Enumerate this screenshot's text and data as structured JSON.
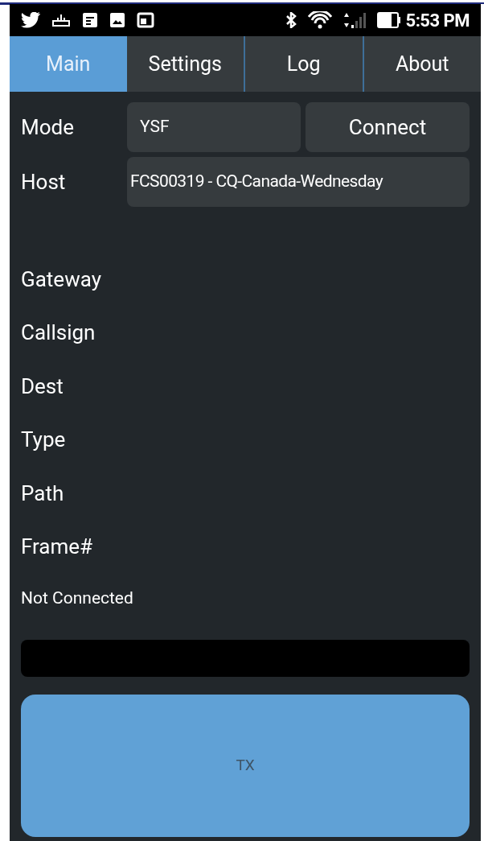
{
  "status_bar": {
    "time": "5:53 PM"
  },
  "tabs": [
    {
      "label": "Main",
      "selected": true
    },
    {
      "label": "Settings",
      "selected": false
    },
    {
      "label": "Log",
      "selected": false
    },
    {
      "label": "About",
      "selected": false
    }
  ],
  "mode": {
    "label": "Mode",
    "value": "YSF"
  },
  "connect_button": {
    "label": "Connect"
  },
  "host": {
    "label": "Host",
    "value": "FCS00319 - CQ-Canada-Wednesday"
  },
  "fields": [
    {
      "label": "Gateway"
    },
    {
      "label": "Callsign"
    },
    {
      "label": "Dest"
    },
    {
      "label": "Type"
    },
    {
      "label": "Path"
    },
    {
      "label": "Frame#"
    }
  ],
  "status": "Not Connected",
  "tx_button": {
    "label": "TX",
    "disabled": true
  }
}
